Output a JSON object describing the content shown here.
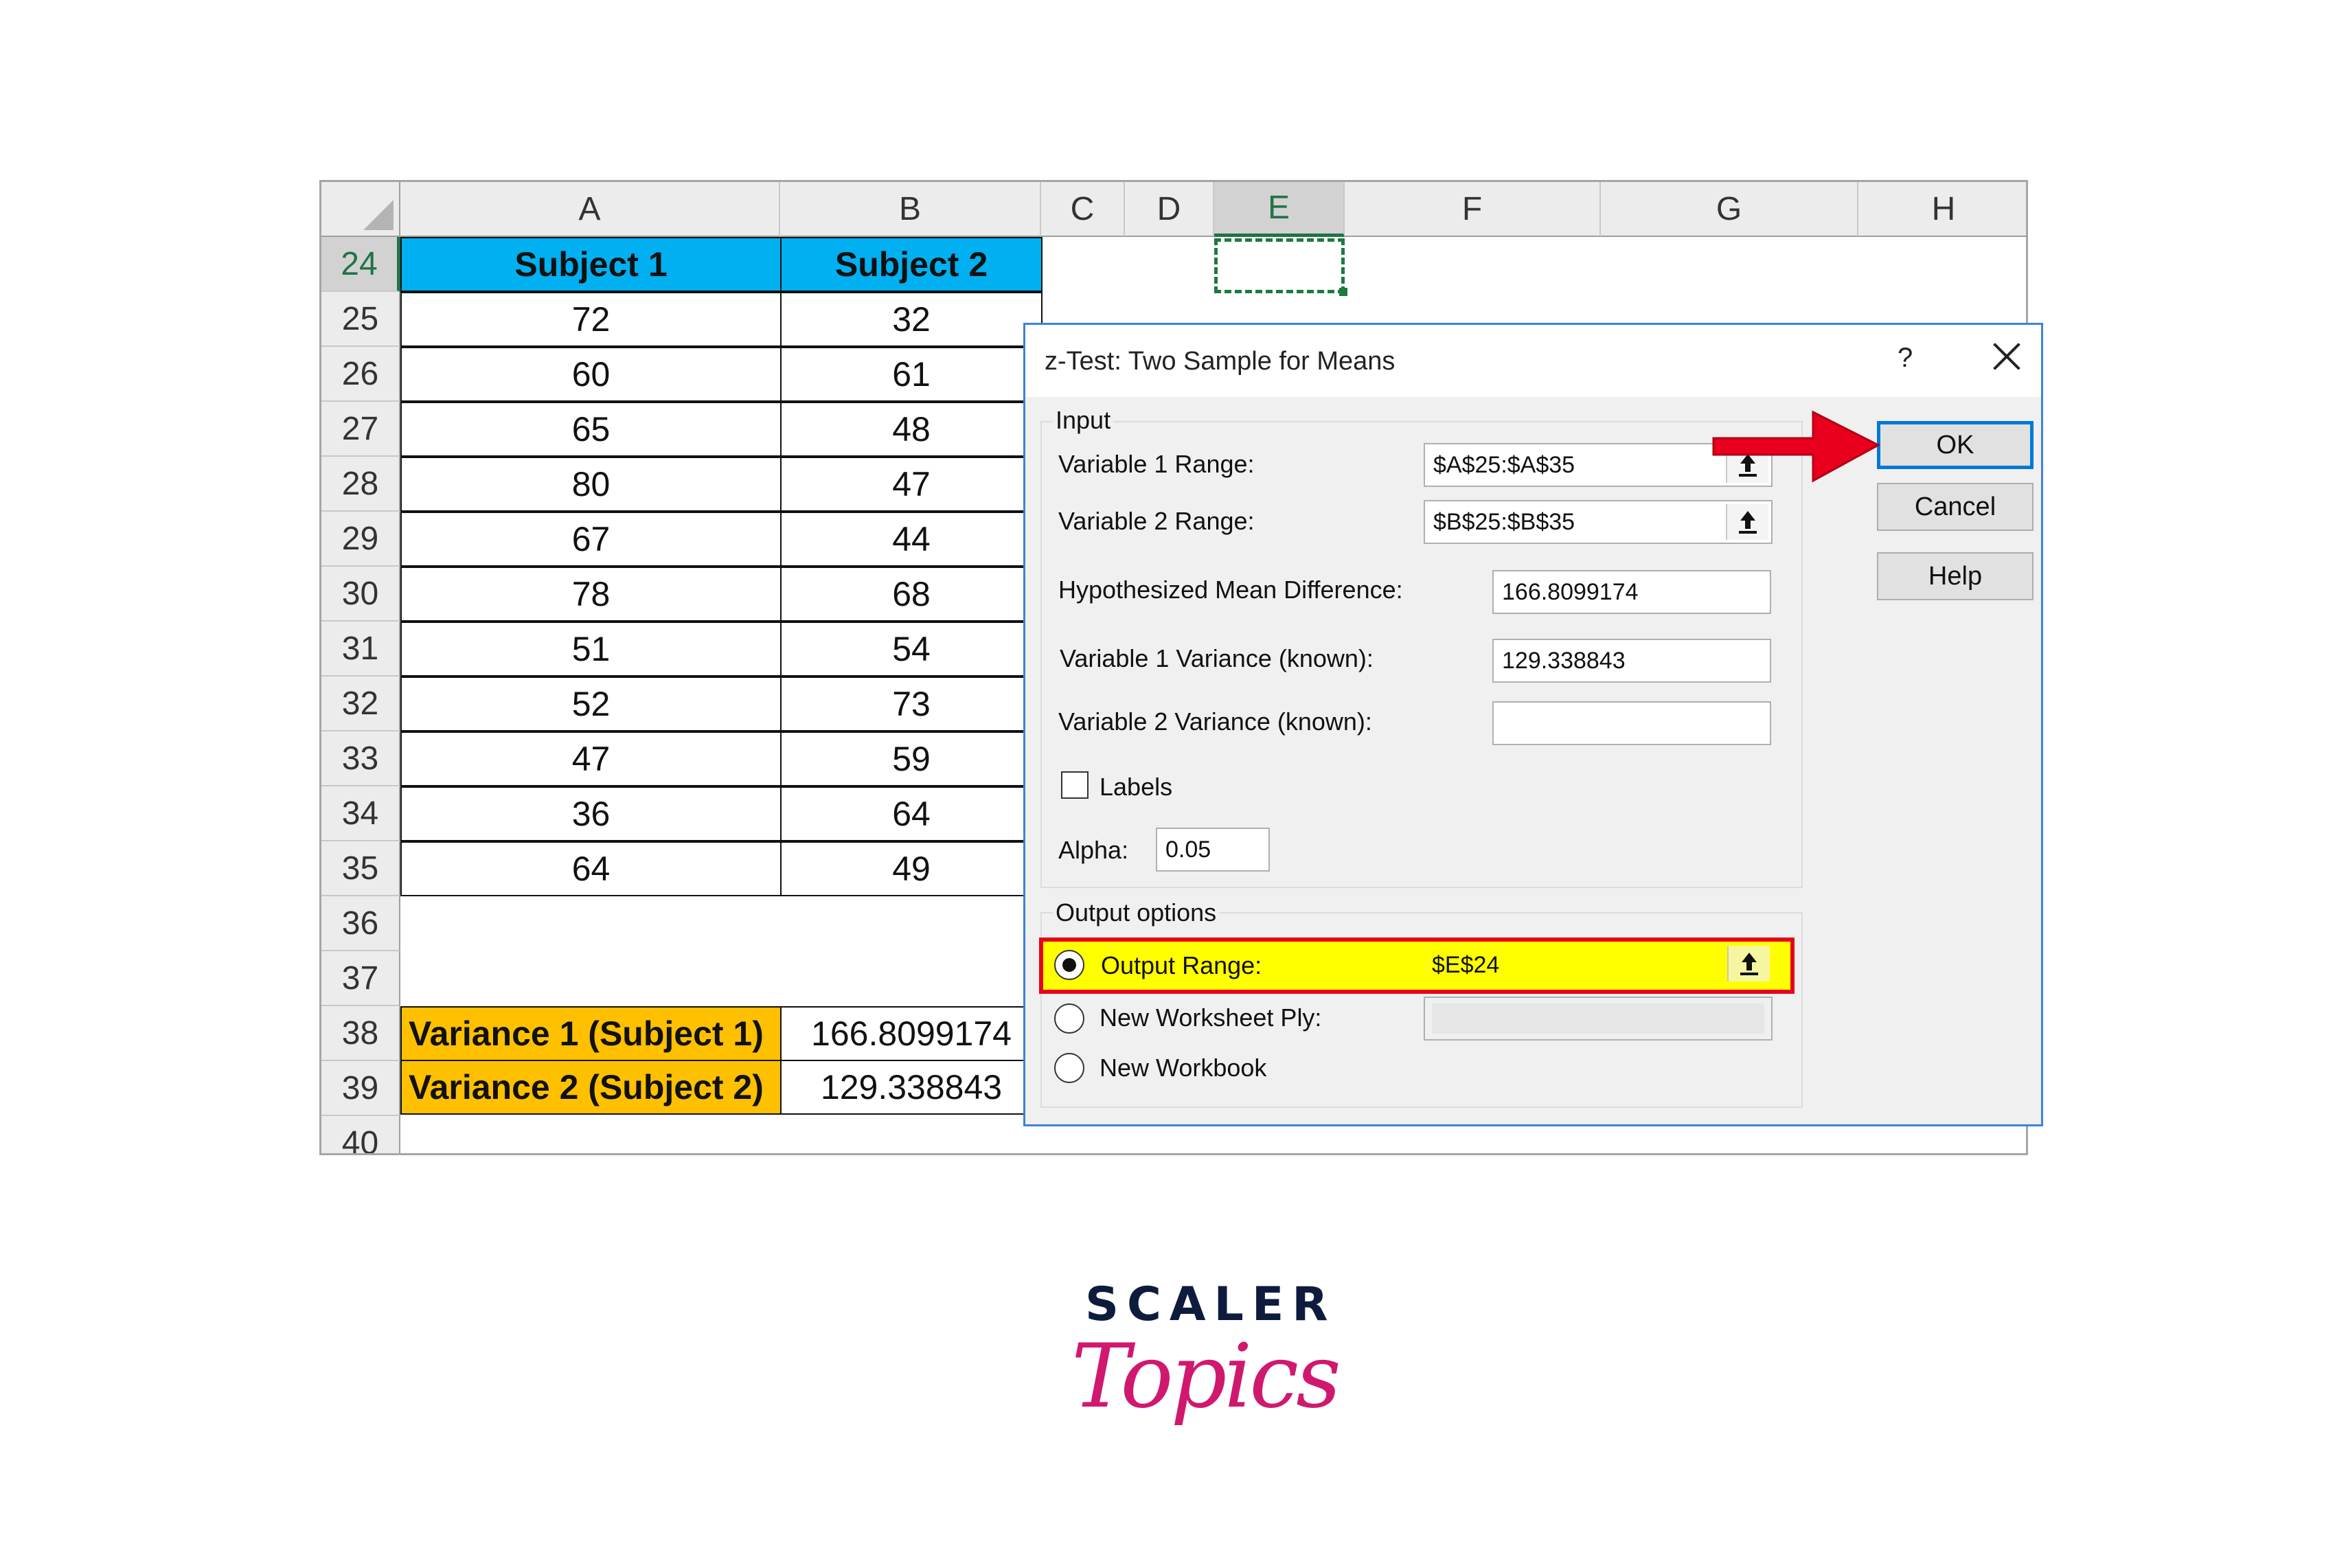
{
  "sheet": {
    "columns": [
      "A",
      "B",
      "C",
      "D",
      "E",
      "F",
      "G",
      "H"
    ],
    "selected_column": "E",
    "rows": [
      "24",
      "25",
      "26",
      "27",
      "28",
      "29",
      "30",
      "31",
      "32",
      "33",
      "34",
      "35",
      "36",
      "37",
      "38",
      "39",
      "40"
    ],
    "selected_row": "24",
    "header": {
      "subject1": "Subject 1",
      "subject2": "Subject 2"
    },
    "data": [
      [
        "72",
        "32"
      ],
      [
        "60",
        "61"
      ],
      [
        "65",
        "48"
      ],
      [
        "80",
        "47"
      ],
      [
        "67",
        "44"
      ],
      [
        "78",
        "68"
      ],
      [
        "51",
        "54"
      ],
      [
        "52",
        "73"
      ],
      [
        "47",
        "59"
      ],
      [
        "36",
        "64"
      ],
      [
        "64",
        "49"
      ]
    ],
    "variance1_label": "Variance 1 (Subject 1)",
    "variance1_value": "166.8099174",
    "variance2_label": "Variance 2 (Subject 2)",
    "variance2_value": "129.338843",
    "colors": {
      "header_fill": "#00b0f0",
      "variance_fill": "#ffc000",
      "selection": "#217346"
    }
  },
  "dialog": {
    "title": "z-Test: Two Sample for Means",
    "help_glyph": "?",
    "input_group": "Input",
    "var1_range_label": "Variable 1 Range:",
    "var1_range_value": "$A$25:$A$35",
    "var2_range_label": "Variable 2 Range:",
    "var2_range_value": "$B$25:$B$35",
    "hyp_mean_label": "Hypothesized Mean Difference:",
    "hyp_mean_value": "166.8099174",
    "var1_variance_label": "Variable 1 Variance (known):",
    "var1_variance_value": "129.338843",
    "var2_variance_label": "Variable 2 Variance (known):",
    "var2_variance_value": "",
    "labels_checkbox": "Labels",
    "alpha_label": "Alpha:",
    "alpha_value": "0.05",
    "output_group": "Output options",
    "output_range_label": "Output Range:",
    "output_range_value": "$E$24",
    "new_ply_label": "New Worksheet Ply:",
    "new_workbook_label": "New Workbook",
    "ok": "OK",
    "cancel": "Cancel",
    "help": "Help",
    "colors": {
      "highlight_fill": "#ffff00",
      "highlight_border": "#e8001c",
      "arrow": "#e8001c"
    }
  },
  "logo": {
    "line1": "SCALER",
    "line2": "Topics"
  }
}
